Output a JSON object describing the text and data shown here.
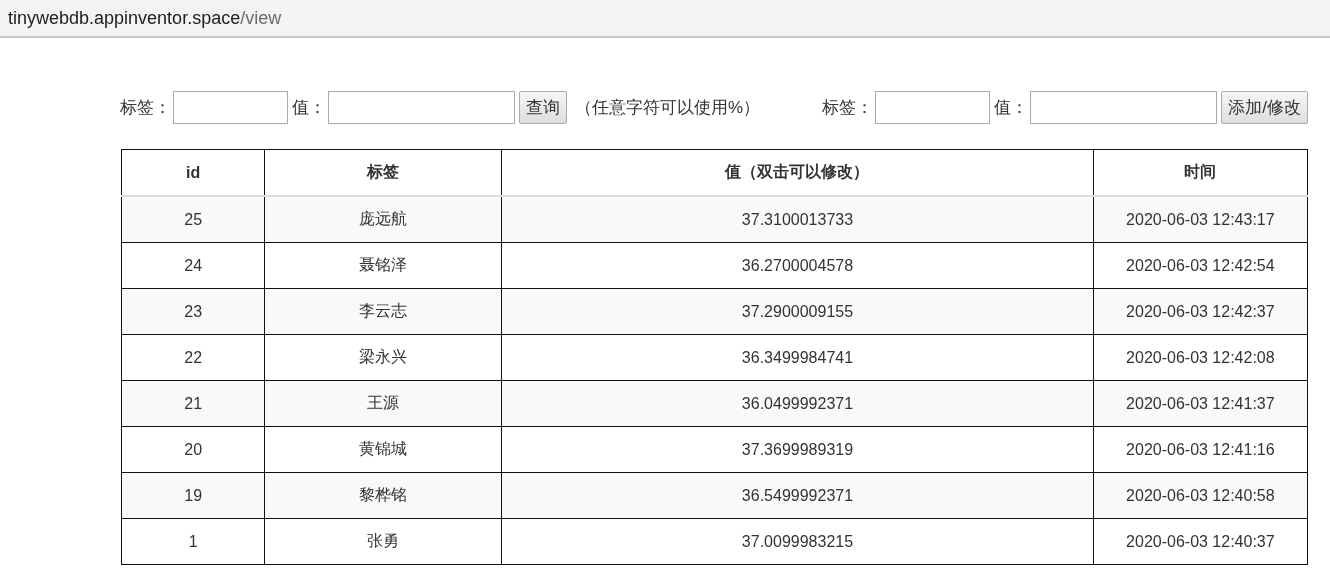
{
  "address_bar": {
    "host": "tinywebdb.appinventor.space",
    "path": "/view"
  },
  "query_form": {
    "tag_label": "标签：",
    "value_label": "值：",
    "button": "查询",
    "hint": "（任意字符可以使用%）"
  },
  "edit_form": {
    "tag_label": "标签：",
    "value_label": "值：",
    "button": "添加/修改"
  },
  "table": {
    "columns": [
      "id",
      "标签",
      "值（双击可以修改）",
      "时间"
    ],
    "rows": [
      [
        "25",
        "庞远航",
        "37.3100013733",
        "2020-06-03 12:43:17"
      ],
      [
        "24",
        "聂铭泽",
        "36.2700004578",
        "2020-06-03 12:42:54"
      ],
      [
        "23",
        "李云志",
        "37.2900009155",
        "2020-06-03 12:42:37"
      ],
      [
        "22",
        "梁永兴",
        "36.3499984741",
        "2020-06-03 12:42:08"
      ],
      [
        "21",
        "王源",
        "36.0499992371",
        "2020-06-03 12:41:37"
      ],
      [
        "20",
        "黄锦城",
        "37.3699989319",
        "2020-06-03 12:41:16"
      ],
      [
        "19",
        "黎桦铭",
        "36.5499992371",
        "2020-06-03 12:40:58"
      ],
      [
        "1",
        "张勇",
        "37.0099983215",
        "2020-06-03 12:40:37"
      ]
    ]
  }
}
